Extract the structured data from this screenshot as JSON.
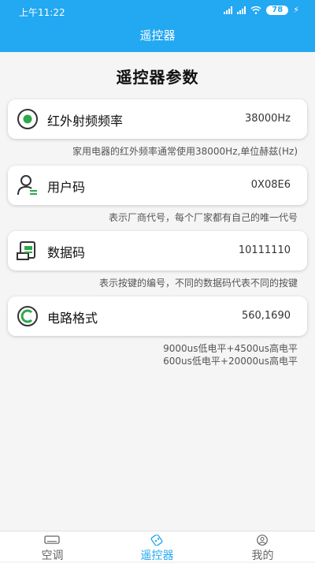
{
  "status_bar": {
    "time": "上午11:22",
    "battery": "78"
  },
  "header": {
    "title": "遥控器"
  },
  "page": {
    "title": "遥控器参数"
  },
  "params": [
    {
      "label": "红外射频频率",
      "value": "38000Hz",
      "icon": "target-icon",
      "desc": [
        "家用电器的红外频率通常使用38000Hz,单位赫兹(Hz)"
      ]
    },
    {
      "label": "用户码",
      "value": "0X08E6",
      "icon": "user-icon",
      "desc": [
        "表示厂商代号，每个厂家都有自己的唯一代号"
      ]
    },
    {
      "label": "数据码",
      "value": "10111110",
      "icon": "receipt-icon",
      "desc": [
        "表示按键的编号，不同的数据码代表不同的按键"
      ]
    },
    {
      "label": "电路格式",
      "value": "560,1690",
      "icon": "c-circle-icon",
      "desc": [
        "9000us低电平+4500us高电平",
        "600us低电平+20000us高电平"
      ]
    }
  ],
  "tabs": [
    {
      "label": "空调",
      "icon": "air-conditioner-icon",
      "active": false
    },
    {
      "label": "遥控器",
      "icon": "remote-icon",
      "active": true
    },
    {
      "label": "我的",
      "icon": "profile-icon",
      "active": false
    }
  ],
  "colors": {
    "primary": "#23a8f2",
    "icon_green": "#2ea84a",
    "icon_dark": "#333333"
  }
}
